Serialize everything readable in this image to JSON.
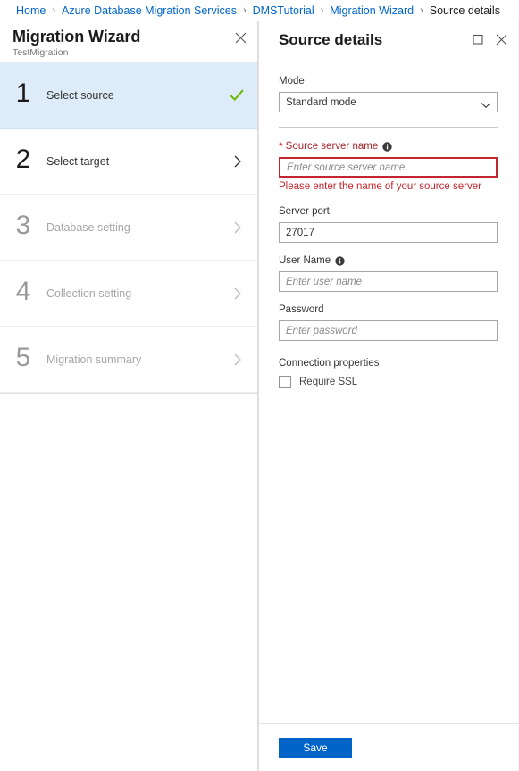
{
  "breadcrumb": {
    "separator": "›",
    "items": [
      {
        "label": "Home",
        "current": false
      },
      {
        "label": "Azure Database Migration Services",
        "current": false
      },
      {
        "label": "DMSTutorial",
        "current": false
      },
      {
        "label": "Migration Wizard",
        "current": false
      },
      {
        "label": "Source details",
        "current": true
      }
    ]
  },
  "left_blade": {
    "title": "Migration Wizard",
    "subtitle": "TestMigration",
    "close_icon": "close-icon",
    "steps": [
      {
        "number": "1",
        "label": "Select source",
        "state": "active",
        "trailing": "check"
      },
      {
        "number": "2",
        "label": "Select target",
        "state": "enabled",
        "trailing": "chevron"
      },
      {
        "number": "3",
        "label": "Database setting",
        "state": "disabled",
        "trailing": "chevron"
      },
      {
        "number": "4",
        "label": "Collection setting",
        "state": "disabled",
        "trailing": "chevron"
      },
      {
        "number": "5",
        "label": "Migration summary",
        "state": "disabled",
        "trailing": "chevron"
      }
    ]
  },
  "right_blade": {
    "title": "Source details",
    "maximize_icon": "maximize-icon",
    "close_icon": "close-icon",
    "mode": {
      "label": "Mode",
      "value": "Standard mode",
      "options": [
        "Standard mode"
      ]
    },
    "source_server_name": {
      "label": "Source server name",
      "required_marker": "*",
      "info_icon": "info-icon",
      "value": "",
      "placeholder": "Enter source server name",
      "error": "Please enter the name of your source server"
    },
    "server_port": {
      "label": "Server port",
      "value": "27017",
      "placeholder": ""
    },
    "user_name": {
      "label": "User Name",
      "info_icon": "info-icon",
      "value": "",
      "placeholder": "Enter user name"
    },
    "password": {
      "label": "Password",
      "value": "",
      "placeholder": "Enter password"
    },
    "connection_properties": {
      "label": "Connection properties",
      "require_ssl": {
        "label": "Require SSL",
        "checked": false
      }
    },
    "save_label": "Save"
  },
  "colors": {
    "link": "#0066cc",
    "active_step_bg": "#deecf9",
    "error_red": "#c3262e",
    "check_green": "#6bb700",
    "primary_button": "#0063c8"
  }
}
